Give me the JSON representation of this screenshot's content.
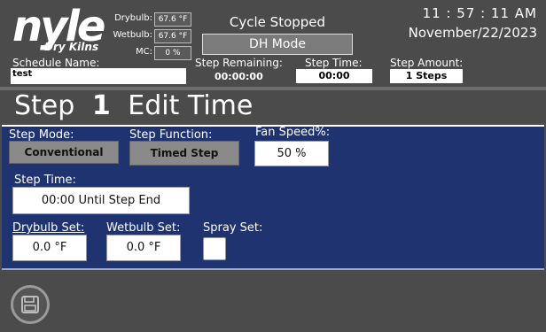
{
  "header": {
    "logo_word": "nyle",
    "logo_sub": "Dry Kilns",
    "drybulb_label": "Drybulb:",
    "drybulb_value": "67.6 °F",
    "wetbulb_label": "Wetbulb:",
    "wetbulb_value": "67.6 °F",
    "mc_label": "MC:",
    "mc_value": "0 %",
    "status": "Cycle Stopped",
    "mode": "DH Mode",
    "time": "11 : 57 : 11  AM",
    "date": "November/22/2023",
    "schedule_name_label": "Schedule Name:",
    "schedule_name_value": "test",
    "step_remaining_label": "Step Remaining:",
    "step_remaining_value": "00:00:00",
    "step_time_label": "Step Time:",
    "step_time_value": "00:00",
    "step_amount_label": "Step Amount:",
    "step_amount_value": "1 Steps"
  },
  "title": {
    "prefix": "Step",
    "number": "1",
    "suffix": "Edit Time"
  },
  "panel": {
    "step_mode_label": "Step Mode:",
    "step_mode_value": "Conventional",
    "step_function_label": "Step Function:",
    "step_function_value": "Timed Step",
    "fan_speed_label": "Fan Speed%:",
    "fan_speed_value": "50 %",
    "step_time_label": "Step Time:",
    "step_time_value": "00:00 Until Step End",
    "drybulb_set_label": "Drybulb Set:",
    "drybulb_set_value": "0.0 °F",
    "wetbulb_set_label": "Wetbulb Set:",
    "wetbulb_set_value": "0.0 °F",
    "spray_set_label": "Spray Set:",
    "spray_set_checked": false
  },
  "icons": {
    "save": "floppy-disk-icon"
  }
}
